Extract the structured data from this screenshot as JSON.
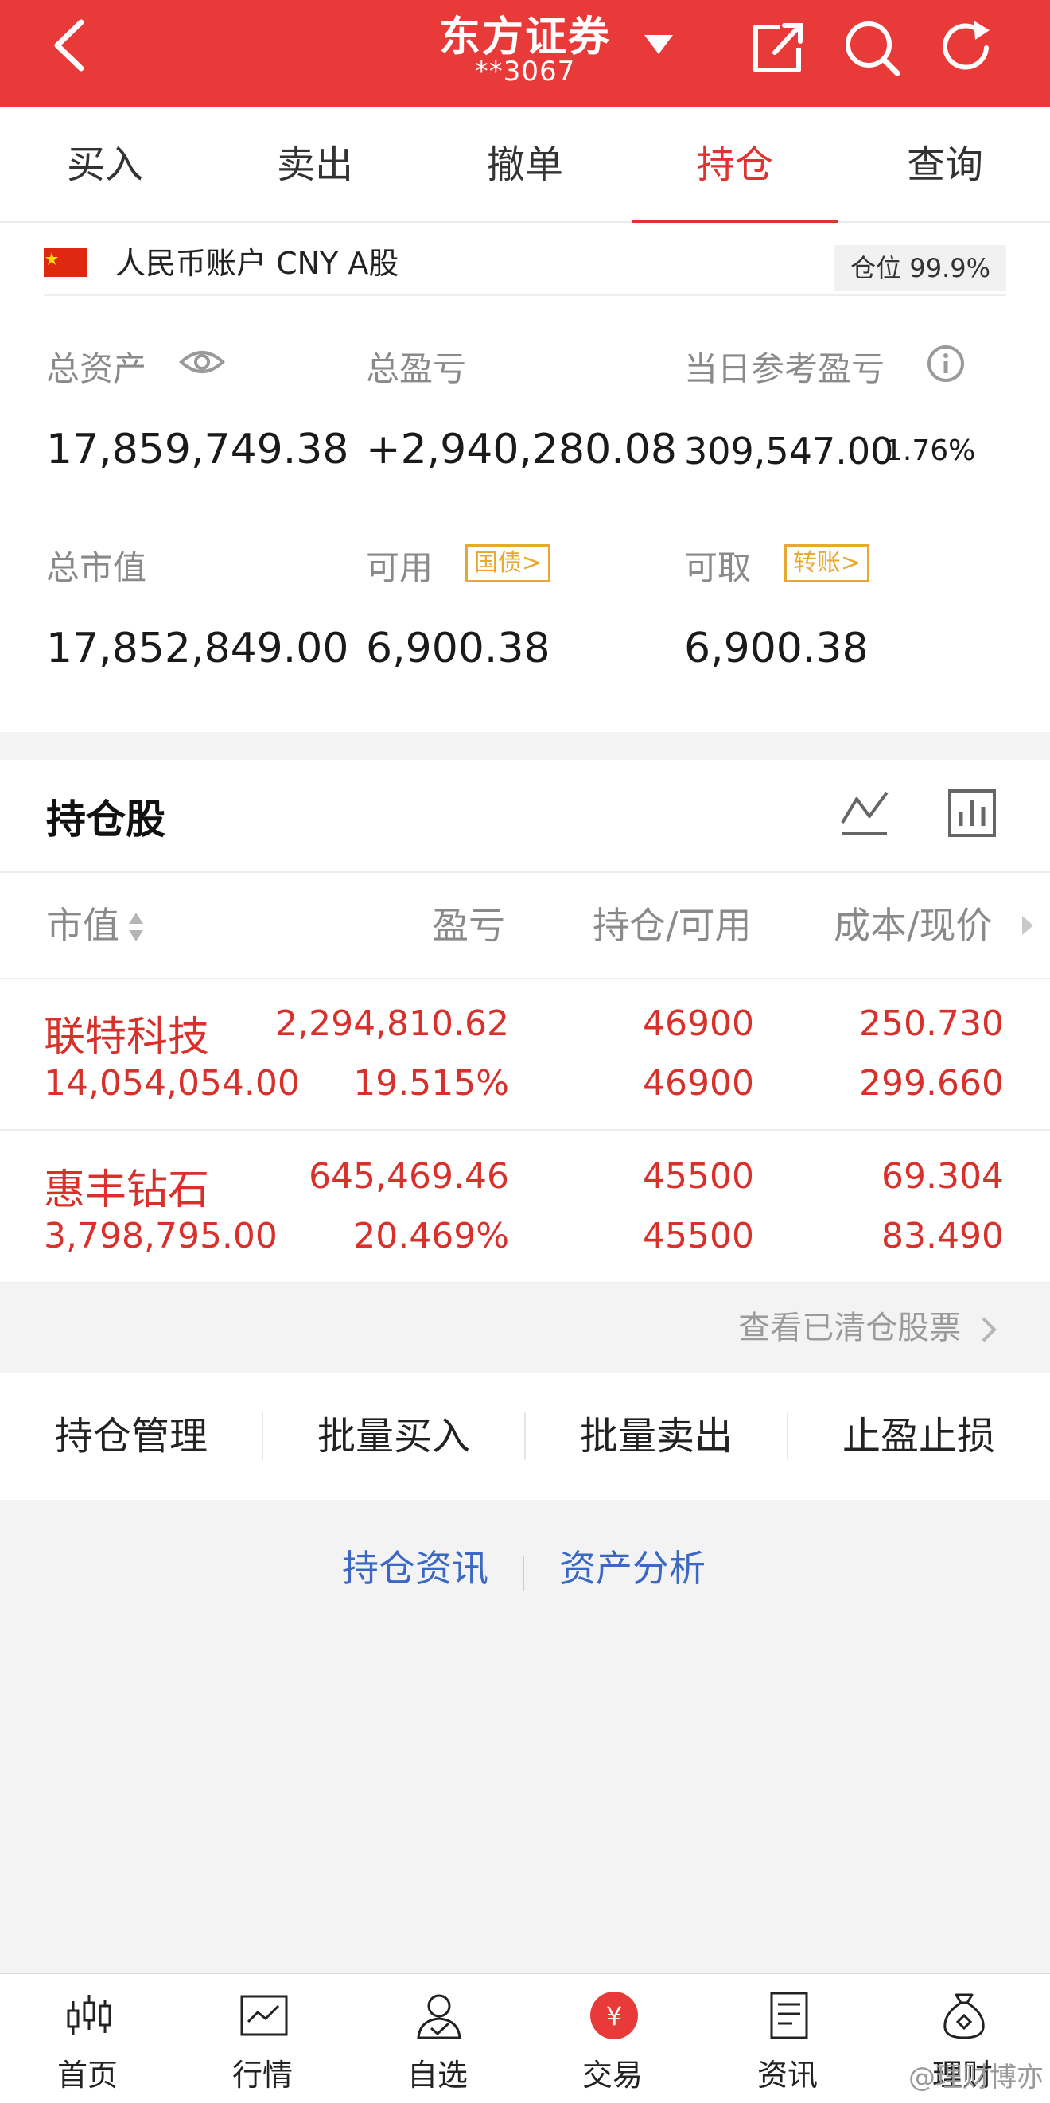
{
  "header": {
    "title": "东方证券",
    "account": "**3067"
  },
  "tabs": [
    "买入",
    "卖出",
    "撤单",
    "持仓",
    "查询"
  ],
  "account_bar": {
    "label": "人民币账户 CNY A股",
    "position": "仓位 99.9%"
  },
  "metrics": {
    "total_assets_label": "总资产",
    "total_assets": "17,859,749.38",
    "total_pl_label": "总盈亏",
    "total_pl": "+2,940,280.08",
    "daily_pl_label": "当日参考盈亏",
    "daily_pl": "309,547.00",
    "daily_pl_pct": "1.76%",
    "market_value_label": "总市值",
    "market_value": "17,852,849.00",
    "available_label": "可用",
    "available_badge": "国债>",
    "available": "6,900.38",
    "withdrawable_label": "可取",
    "withdrawable_badge": "转账>",
    "withdrawable": "6,900.38"
  },
  "holdings": {
    "title": "持仓股",
    "columns": [
      "市值",
      "盈亏",
      "持仓/可用",
      "成本/现价"
    ],
    "rows": [
      {
        "name": "联特科技",
        "market_value": "14,054,054.00",
        "pl": "2,294,810.62",
        "pl_pct": "19.515%",
        "position": "46900",
        "available": "46900",
        "cost": "250.730",
        "price": "299.660"
      },
      {
        "name": "惠丰钻石",
        "market_value": "3,798,795.00",
        "pl": "645,469.46",
        "pl_pct": "20.469%",
        "position": "45500",
        "available": "45500",
        "cost": "69.304",
        "price": "83.490"
      }
    ],
    "cleared_link": "查看已清仓股票"
  },
  "actions": [
    "持仓管理",
    "批量买入",
    "批量卖出",
    "止盈止损"
  ],
  "info_links": [
    "持仓资讯",
    "资产分析"
  ],
  "nav": [
    {
      "label": "首页",
      "icon": "candlestick-icon"
    },
    {
      "label": "行情",
      "icon": "chart-icon"
    },
    {
      "label": "自选",
      "icon": "user-check-icon"
    },
    {
      "label": "交易",
      "icon": "yuan-icon"
    },
    {
      "label": "资讯",
      "icon": "document-icon"
    },
    {
      "label": "理财",
      "icon": "money-bag-icon"
    }
  ],
  "watermark": "@理财博亦",
  "colors": {
    "brand_red": "#e93a3a",
    "profit_red": "#d8312c",
    "link_blue": "#3a68c4",
    "badge_gold": "#e8a934"
  }
}
